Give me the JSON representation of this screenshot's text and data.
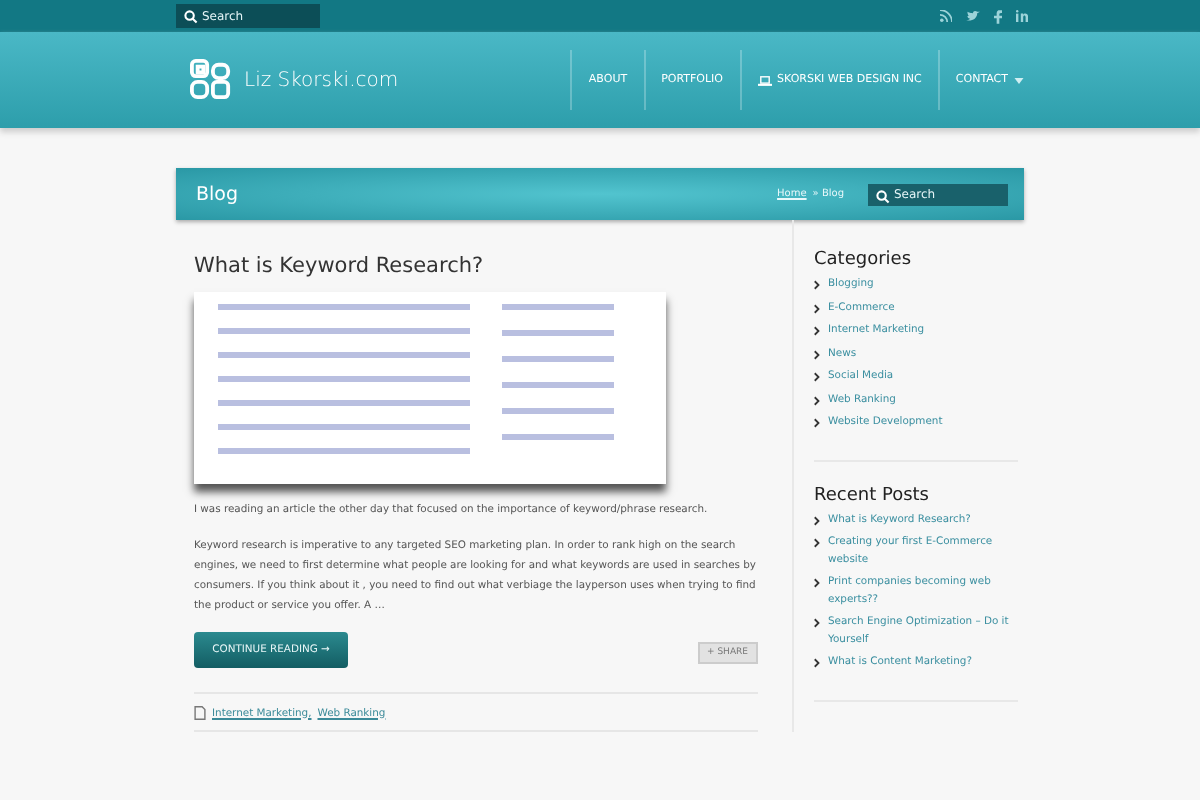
{
  "topbar": {
    "search_placeholder": "Search"
  },
  "header": {
    "logo_text": "Liz  Skorski.com",
    "nav": [
      {
        "label": "ABOUT",
        "kind": "plain"
      },
      {
        "label": "PORTFOLIO",
        "kind": "plain"
      },
      {
        "label": "SKORSKI WEB DESIGN INC",
        "kind": "icon"
      },
      {
        "label": "CONTACT",
        "kind": "dropdown"
      }
    ]
  },
  "page_bar": {
    "title": "Blog",
    "breadcrumb": [
      "Home",
      "Blog"
    ],
    "separator": "»",
    "search_placeholder": "Search"
  },
  "post": {
    "title": "What is Keyword Research?",
    "paragraphs": [
      "I was reading an article the other day that focused on the importance of keyword/phrase research.",
      "Keyword research is imperative to any targeted SEO marketing plan. In order to rank high on the search engines, we need to first determine what people are looking for and what keywords are used in searches by  consumers.  If you think about it , you need to find out what verbiage the layperson uses when trying to find the product or service you offer.  A …"
    ],
    "continue_button": "CONTINUE READING →",
    "share_button": "+ SHARE",
    "tags": [
      "Internet Marketing,",
      "Web Ranking"
    ]
  },
  "sidebar": {
    "categories_title": "Categories",
    "categories": [
      "Blogging",
      "E-Commerce",
      "Internet Marketing",
      "News",
      "Social Media",
      "Web Ranking",
      "Website Development"
    ],
    "recent_title": "Recent Posts",
    "recent": [
      "What is Keyword Research?",
      "Creating your first E-Commerce website",
      "Print companies becoming web experts??",
      "Search Engine Optimization – Do it Yourself",
      "What is Content Marketing?"
    ]
  }
}
